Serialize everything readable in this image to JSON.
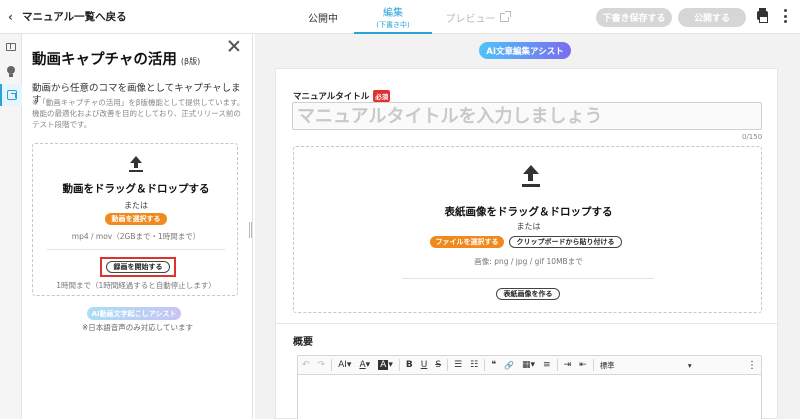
{
  "header": {
    "back_label": "マニュアル一覧へ戻る",
    "tabs": [
      {
        "label": "公開中"
      },
      {
        "label": "編集",
        "sub": "(下書き中)"
      },
      {
        "label": "プレビュー"
      }
    ],
    "draft_save_label": "下書き保存する",
    "publish_label": "公開する"
  },
  "panel": {
    "title": "動画キャプチャの活用",
    "beta": "(β版)",
    "description": "動画から任意のコマを画像としてキャプチャします",
    "note": "※「動画キャプチャの活用」をβ版機能として提供しています。機能の最適化および改善を目的としており、正式リリース前のテスト段階です。",
    "drop_title": "動画をドラッグ＆ドロップする",
    "or_text": "または",
    "select_video_label": "動画を選択する",
    "format_text": "mp4 / mov（2GBまで・1時間まで）",
    "record_label": "録画を開始する",
    "limit_text": "1時間まで（1時間経過すると自動停止します）",
    "ai_subtitle_label": "AI動画文字起こしアシスト",
    "ai_subtitle_note": "※日本語音声のみ対応しています"
  },
  "editor": {
    "ai_assist_label": "AI文章編集アシスト",
    "title_label": "マニュアルタイトル",
    "required_badge": "必須",
    "title_placeholder": "マニュアルタイトルを入力しましょう",
    "char_count": "0/150",
    "cover_drop_title": "表紙画像をドラッグ＆ドロップする",
    "cover_or": "または",
    "select_file_label": "ファイルを選択する",
    "paste_clipboard_label": "クリップボードから貼り付ける",
    "cover_format": "画像: png / jpg / gif 10MBまで",
    "make_cover_label": "表紙画像を作る",
    "summary_label": "概要",
    "toolbar": {
      "undo": "↶",
      "redo": "↷",
      "ai": "AI",
      "font_color": "A",
      "highlight": "A",
      "bold": "B",
      "underline": "U",
      "strike": "S",
      "bullet_list": "☰",
      "numbered_list": "☷",
      "quote": "❝",
      "link": "🔗",
      "table": "▦",
      "align": "≡",
      "indent": "⇥",
      "outdent": "⇤",
      "format_value": "標準",
      "more": "⋮"
    }
  },
  "colors": {
    "accent": "#29a3d6",
    "orange": "#f0891e",
    "required_red": "#e0312f",
    "highlight_box": "#e0312f"
  }
}
